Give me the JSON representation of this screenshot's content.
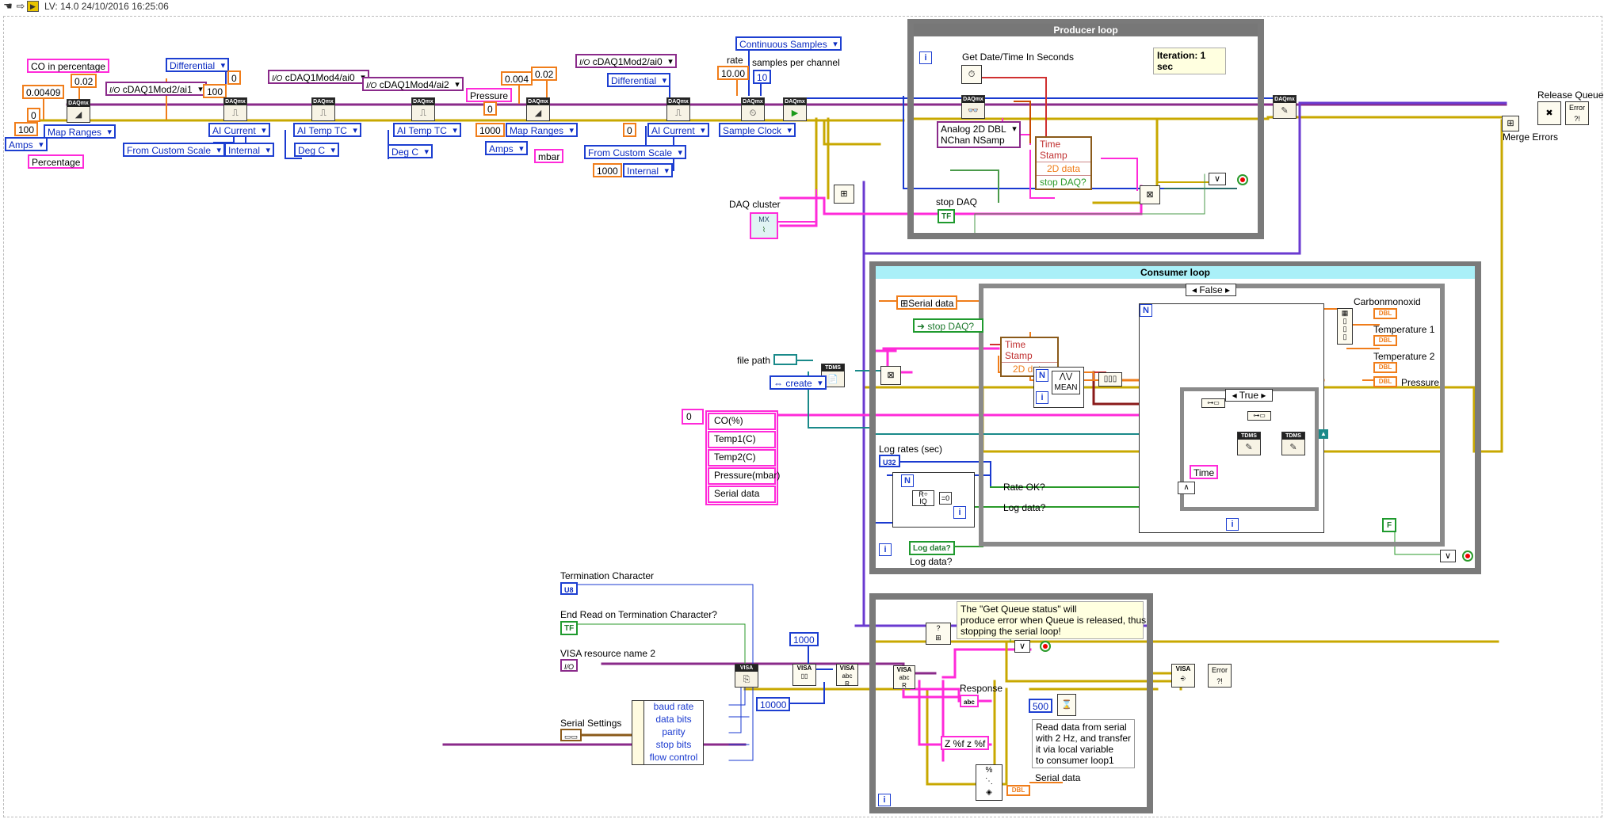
{
  "toolbar": {
    "version": "LV: 14.0 24/10/2016 16:25:06",
    "icons": [
      "hand-icon",
      "step-over-icon",
      "step-arrow-icon",
      "highlight-bulb-icon"
    ]
  },
  "producer": {
    "title": "Producer loop",
    "get_date_label": "Get Date/Time In Seconds",
    "iteration_label": "Iteration: 1 sec",
    "read_mode": "Analog 2D DBL\nNChan NSamp",
    "cluster_fields": [
      "Time Stamp",
      "2D data",
      "stop DAQ?"
    ],
    "stop_label": "stop DAQ",
    "tf": "TF"
  },
  "consumer": {
    "title": "Consumer loop",
    "case_false": "False",
    "case_true": "True",
    "serial_data_local": "Serial data",
    "stop_daq_field": "stop DAQ?",
    "unbundle_fields": [
      "Time Stamp",
      "2D data"
    ],
    "mean_label": "MEAN",
    "time_label": "Time",
    "rate_ok": "Rate OK?",
    "log_data_q": "Log data?",
    "log_rates": "Log rates (sec)",
    "u32": "U32",
    "log_data": "Log data?",
    "carbon": "Carbonmonoxid",
    "temp1": "Temperature 1",
    "temp2": "Temperature 2",
    "pressure": "Pressure",
    "dbl": "DBL",
    "false_const": "F"
  },
  "daq": {
    "co_percentage": "CO in percentage",
    "val_002": "0.02",
    "val_000409": "0.00409",
    "val_0": "0",
    "val_100": "100",
    "amps": "Amps",
    "map_ranges": "Map Ranges",
    "percentage": "Percentage",
    "ch_mod2_ai1": "cDAQ1Mod2/ai1",
    "differential": "Differential",
    "ai_current": "AI Current",
    "from_custom_scale": "From Custom Scale",
    "internal": "Internal",
    "ch_mod4_ai0": "cDAQ1Mod4/ai0",
    "ai_temp_tc": "AI Temp TC",
    "deg_c": "Deg C",
    "ch_mod4_ai2": "cDAQ1Mod4/ai2",
    "pressure": "Pressure",
    "val_0004": "0.004",
    "val_1000": "1000",
    "mbar": "mbar",
    "ch_mod2_ai0": "cDAQ1Mod2/ai0",
    "continuous": "Continuous Samples",
    "rate": "rate",
    "rate_val": "10.00",
    "samples_per_channel": "samples per channel",
    "spc_val": "10",
    "sample_clock": "Sample Clock",
    "daq_cluster": "DAQ cluster",
    "release_queue": "Release Queue",
    "merge_errors": "Merge Errors"
  },
  "file": {
    "file_path": "file path",
    "create": "create",
    "tdms": "TDMS",
    "array_index": "0",
    "channels": [
      "CO(%)",
      "Temp1(C)",
      "Temp2(C)",
      "Pressure(mbar)",
      "Serial data"
    ]
  },
  "serial": {
    "term_char": "Termination Character",
    "u8": "U8",
    "end_read": "End Read on Termination Character?",
    "visa_name": "VISA resource name 2",
    "serial_settings": "Serial Settings",
    "settings_fields": [
      "baud rate",
      "data bits",
      "parity",
      "stop bits",
      "flow control"
    ],
    "val_1000": "1000",
    "val_10000": "10000",
    "comment1": "The \"Get Queue status\" will\nproduce error when Queue is released, thus\nstopping the serial loop!",
    "response": "Response",
    "abc": "abc",
    "format": "Z %f z %f",
    "wait_ms": "500",
    "comment2": "Read data from serial\nwith 2 Hz, and transfer\nit via local variable\nto consumer loop1",
    "serial_data": "Serial data",
    "dbl": "DBL",
    "tf": "TF",
    "visa_short": "I/O"
  },
  "colors": {
    "error_wire": "#c8a800",
    "task_wire": "#8a2a8a",
    "string_wire": "#ff2ad9",
    "int_wire": "#1d3fd1",
    "dbl_wire": "#f07d1a",
    "bool_wire": "#2a9a2a",
    "refnum_wire": "#1a8a8a",
    "loop_border": "#7a7a7a",
    "consumer_header": "#aaf0f8"
  }
}
